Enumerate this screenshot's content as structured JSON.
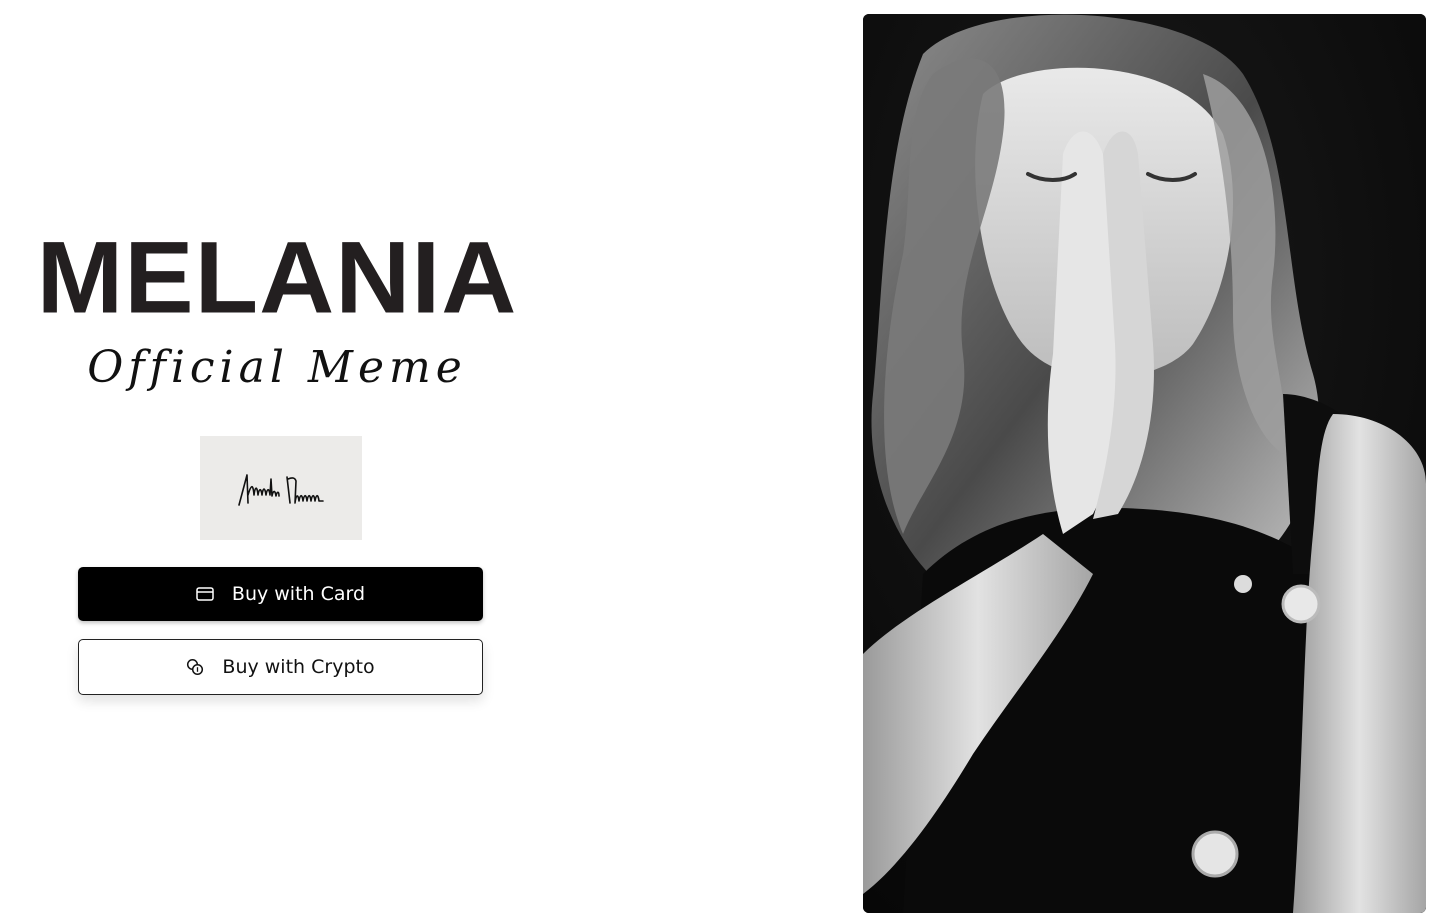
{
  "brand": {
    "title": "MELANIA",
    "subtitle": "Official Meme"
  },
  "signature": {
    "text": "Melania Trump"
  },
  "buttons": {
    "card": {
      "label": "Buy with Card",
      "icon": "credit-card-icon"
    },
    "crypto": {
      "label": "Buy with Crypto",
      "icon": "coins-icon"
    }
  },
  "photo": {
    "style": "black-and-white portrait"
  },
  "colors": {
    "text": "#231f20",
    "button_primary_bg": "#000000",
    "button_primary_text": "#ffffff",
    "button_secondary_border": "#222222",
    "signature_bg": "#ecebe9"
  }
}
